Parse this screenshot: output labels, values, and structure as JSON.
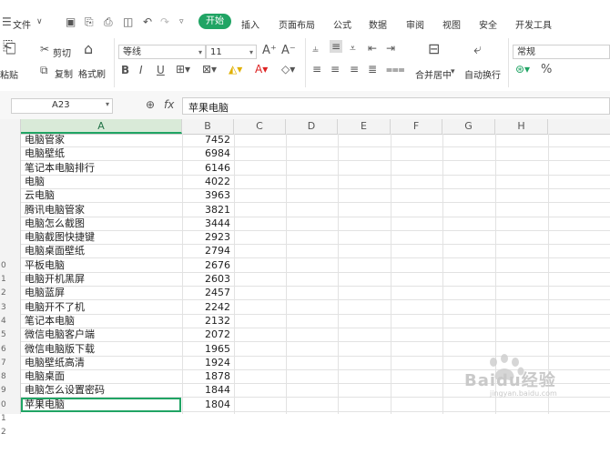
{
  "menubar": {
    "file_label": "文件",
    "tabs": [
      "开始",
      "插入",
      "页面布局",
      "公式",
      "数据",
      "审阅",
      "视图",
      "安全",
      "开发工具"
    ]
  },
  "ribbon": {
    "cut": "剪切",
    "copy": "复制",
    "format_painter": "格式刷",
    "paste": "粘贴",
    "font_name": "等线",
    "font_size": "11",
    "merge_center": "合并居中",
    "wrap_text": "自动换行",
    "number_format": "常规",
    "bold": "B",
    "italic": "I",
    "underline": "U"
  },
  "formula_bar": {
    "name_box": "A23",
    "fx": "fx",
    "content": "苹果电脑"
  },
  "grid": {
    "columns": [
      "A",
      "B",
      "C",
      "D",
      "E",
      "F",
      "G",
      "H"
    ],
    "row_numbers": [
      "",
      "",
      "",
      "",
      "",
      "",
      "",
      "",
      "",
      "0",
      "1",
      "2",
      "3",
      "4",
      "5",
      "6",
      "7",
      "8",
      "9",
      "0",
      "1",
      "2",
      ""
    ],
    "rows": [
      {
        "a": "电脑管家",
        "b": "7452"
      },
      {
        "a": "电脑壁纸",
        "b": "6984"
      },
      {
        "a": "笔记本电脑排行",
        "b": "6146"
      },
      {
        "a": "电脑",
        "b": "4022"
      },
      {
        "a": "云电脑",
        "b": "3963"
      },
      {
        "a": "腾讯电脑管家",
        "b": "3821"
      },
      {
        "a": "电脑怎么截图",
        "b": "3444"
      },
      {
        "a": "电脑截图快捷键",
        "b": "2923"
      },
      {
        "a": "电脑桌面壁纸",
        "b": "2794"
      },
      {
        "a": "平板电脑",
        "b": "2676"
      },
      {
        "a": "电脑开机黑屏",
        "b": "2603"
      },
      {
        "a": "电脑蓝屏",
        "b": "2457"
      },
      {
        "a": "电脑开不了机",
        "b": "2242"
      },
      {
        "a": "笔记本电脑",
        "b": "2132"
      },
      {
        "a": "微信电脑客户端",
        "b": "2072"
      },
      {
        "a": "微信电脑版下载",
        "b": "1965"
      },
      {
        "a": "电脑壁纸高清",
        "b": "1924"
      },
      {
        "a": "电脑桌面",
        "b": "1878"
      },
      {
        "a": "电脑怎么设置密码",
        "b": "1844"
      },
      {
        "a": "苹果电脑",
        "b": "1804"
      }
    ]
  },
  "watermark": {
    "text": "Baidu经验",
    "sub": "jingyan.baidu.com"
  },
  "colors": {
    "accent": "#20a464"
  }
}
